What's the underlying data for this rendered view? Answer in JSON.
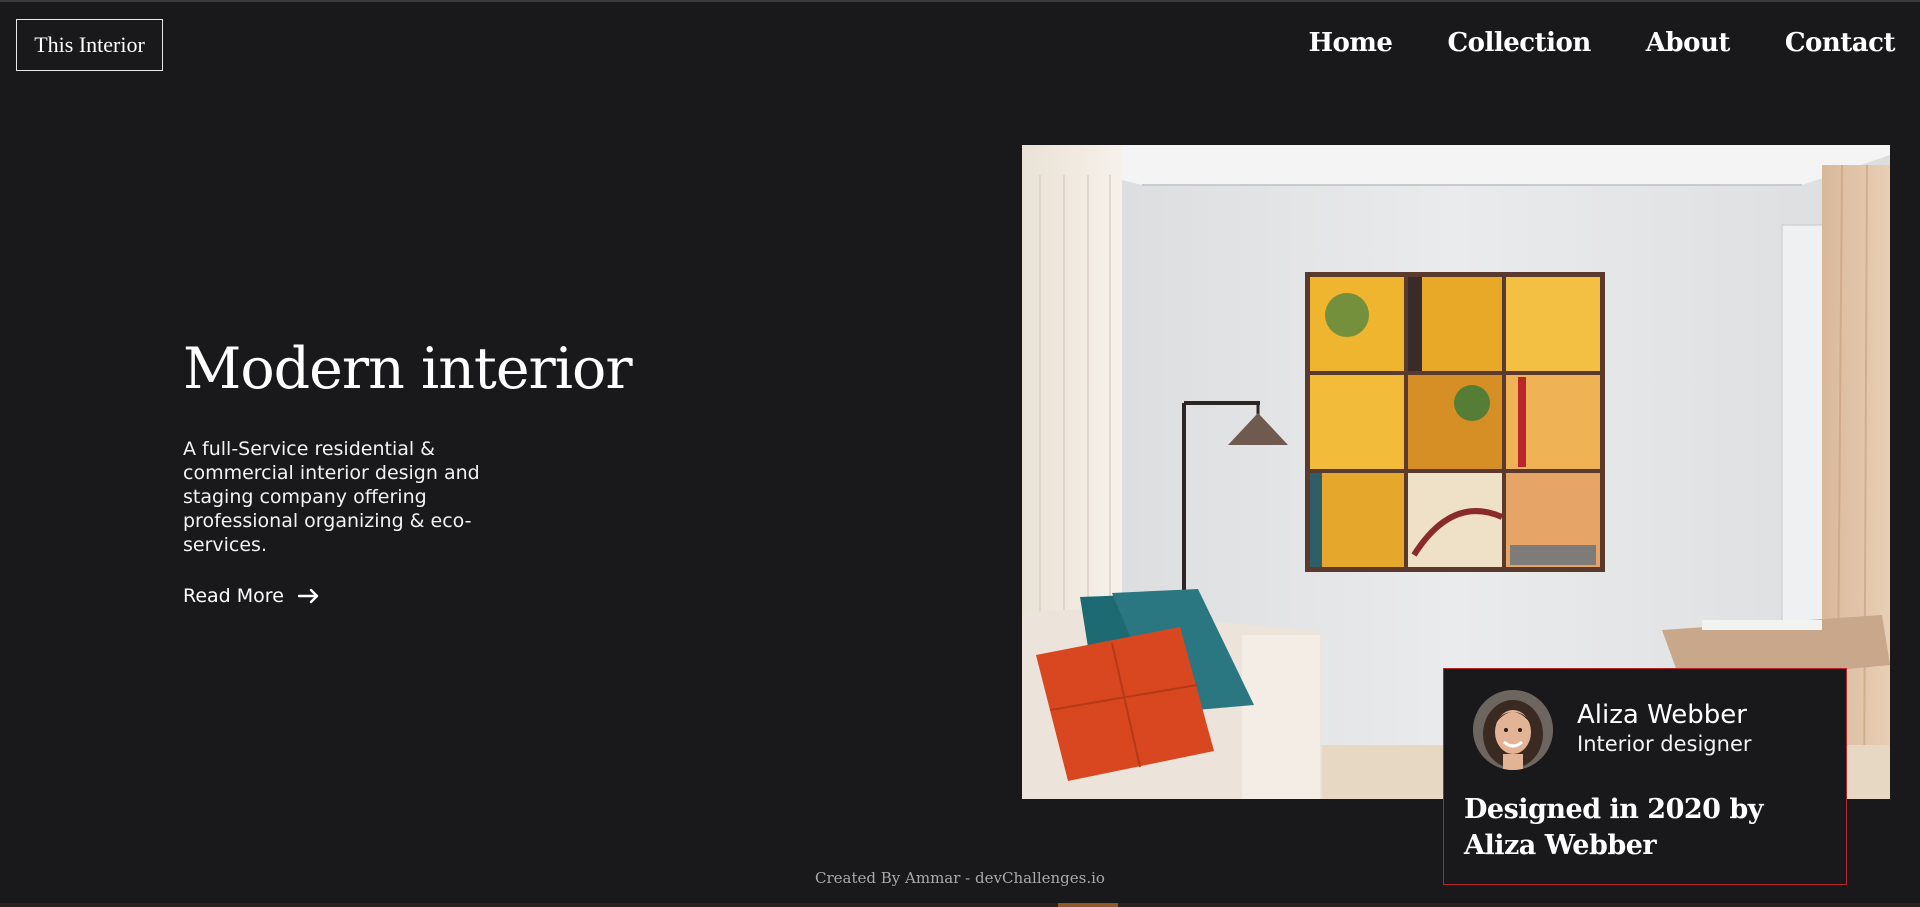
{
  "header": {
    "logo": "This Interior",
    "nav": [
      "Home",
      "Collection",
      "About",
      "Contact"
    ]
  },
  "hero": {
    "title": "Modern interior",
    "description": "A full-Service residential & commercial interior design and staging company offering professional organizing & eco-services.",
    "cta": "Read More"
  },
  "card": {
    "name": "Aliza Webber",
    "role": "Interior designer",
    "caption": "Designed in 2020 by Aliza Webber"
  },
  "footer": {
    "credit": "Created By Ammar - devChallenges.io"
  },
  "icons": {
    "cta_icon": "arrow-right-icon"
  },
  "colors": {
    "background": "#19191b",
    "card_border": "#b3262e"
  }
}
